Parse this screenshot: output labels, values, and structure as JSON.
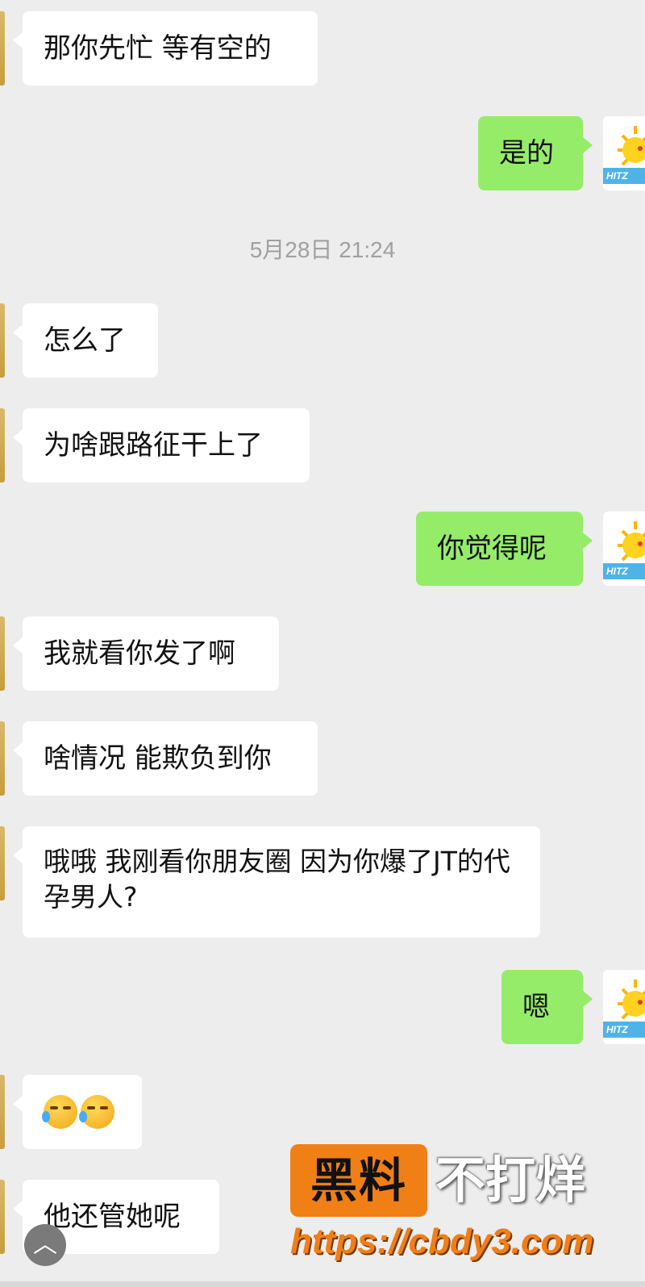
{
  "messages": [
    {
      "side": "in",
      "text": "那你先忙 等有空的"
    },
    {
      "side": "out",
      "text": "是的"
    },
    {
      "side": "in",
      "text": "怎么了"
    },
    {
      "side": "in",
      "text": "为啥跟路征干上了"
    },
    {
      "side": "out",
      "text": "你觉得呢"
    },
    {
      "side": "in",
      "text": "我就看你发了啊"
    },
    {
      "side": "in",
      "text": "啥情况 能欺负到你"
    },
    {
      "side": "in",
      "text": "哦哦  我刚看你朋友圈   因为你爆了JT的代孕男人?"
    },
    {
      "side": "out",
      "text": "嗯"
    },
    {
      "side": "in",
      "emoji": [
        "face-palm-crying-emoji",
        "face-palm-crying-emoji"
      ]
    },
    {
      "side": "in",
      "text": "他还管她呢"
    }
  ],
  "timestamp": "5月28日 21:24",
  "avatar": {
    "tag_text": "HITZ"
  },
  "watermark": {
    "box_text": "黑料",
    "right_text": "不打烊",
    "url": "https://cbdy3.com",
    "color": "#f07f16"
  },
  "scroll_up_icon": "chevron-up-icon"
}
